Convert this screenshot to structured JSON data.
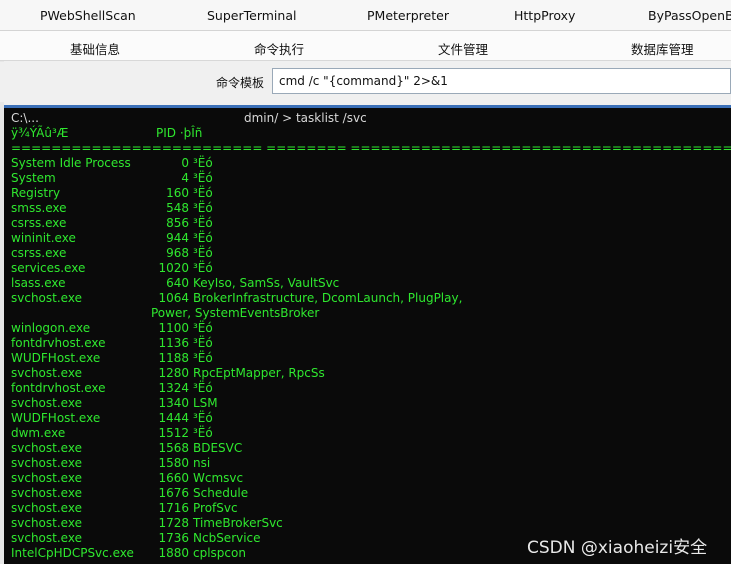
{
  "top_tabs": [
    "PWebShellScan",
    "SuperTerminal",
    "PMeterpreter",
    "HttpProxy",
    "ByPassOpenBa"
  ],
  "sub_tabs": [
    "基础信息",
    "命令执行",
    "文件管理",
    "数据库管理"
  ],
  "command_template": {
    "label": "命令模板",
    "value": "cmd /c \"{command}\" 2>&1"
  },
  "console": {
    "prompt_prefix": "C:\\...",
    "prompt_path": "dmin/ > tasklist /svc",
    "header_name": "ÿ¾ÝÃû³Æ",
    "header_pid": "PID ·þÎñ",
    "separator": "========================= ======== ============================================",
    "rows": [
      {
        "name": "System Idle Process",
        "pid": "0",
        "svc": "³Ëó"
      },
      {
        "name": "System",
        "pid": "4",
        "svc": "³Ëó"
      },
      {
        "name": "Registry",
        "pid": "160",
        "svc": "³Ëó"
      },
      {
        "name": "smss.exe",
        "pid": "548",
        "svc": "³Ëó"
      },
      {
        "name": "csrss.exe",
        "pid": "856",
        "svc": "³Ëó"
      },
      {
        "name": "wininit.exe",
        "pid": "944",
        "svc": "³Ëó"
      },
      {
        "name": "csrss.exe",
        "pid": "968",
        "svc": "³Ëó"
      },
      {
        "name": "services.exe",
        "pid": "1020",
        "svc": "³Ëó"
      },
      {
        "name": "lsass.exe",
        "pid": "640",
        "svc": "KeyIso, SamSs, VaultSvc"
      },
      {
        "name": "svchost.exe",
        "pid": "1064",
        "svc": "BrokerInfrastructure, DcomLaunch, PlugPlay,"
      },
      {
        "name": "",
        "pid": "",
        "svc": "Power, SystemEventsBroker"
      },
      {
        "name": "winlogon.exe",
        "pid": "1100",
        "svc": "³Ëó"
      },
      {
        "name": "fontdrvhost.exe",
        "pid": "1136",
        "svc": "³Ëó"
      },
      {
        "name": "WUDFHost.exe",
        "pid": "1188",
        "svc": "³Ëó"
      },
      {
        "name": "svchost.exe",
        "pid": "1280",
        "svc": "RpcEptMapper, RpcSs"
      },
      {
        "name": "fontdrvhost.exe",
        "pid": "1324",
        "svc": "³Ëó"
      },
      {
        "name": "svchost.exe",
        "pid": "1340",
        "svc": "LSM"
      },
      {
        "name": "WUDFHost.exe",
        "pid": "1444",
        "svc": "³Ëó"
      },
      {
        "name": "dwm.exe",
        "pid": "1512",
        "svc": "³Ëó"
      },
      {
        "name": "svchost.exe",
        "pid": "1568",
        "svc": "BDESVC"
      },
      {
        "name": "svchost.exe",
        "pid": "1580",
        "svc": "nsi"
      },
      {
        "name": "svchost.exe",
        "pid": "1660",
        "svc": "Wcmsvc"
      },
      {
        "name": "svchost.exe",
        "pid": "1676",
        "svc": "Schedule"
      },
      {
        "name": "svchost.exe",
        "pid": "1716",
        "svc": "ProfSvc"
      },
      {
        "name": "svchost.exe",
        "pid": "1728",
        "svc": "TimeBrokerSvc"
      },
      {
        "name": "svchost.exe",
        "pid": "1736",
        "svc": "NcbService"
      },
      {
        "name": "IntelCpHDCPSvc.exe",
        "pid": "1880",
        "svc": "cplspcon"
      }
    ]
  },
  "watermark": "CSDN @xiaoheizi安全",
  "colors": {
    "console_bg": "#0a0a0a",
    "console_text": "#2fe82f",
    "console_border": "#3c70b8"
  }
}
